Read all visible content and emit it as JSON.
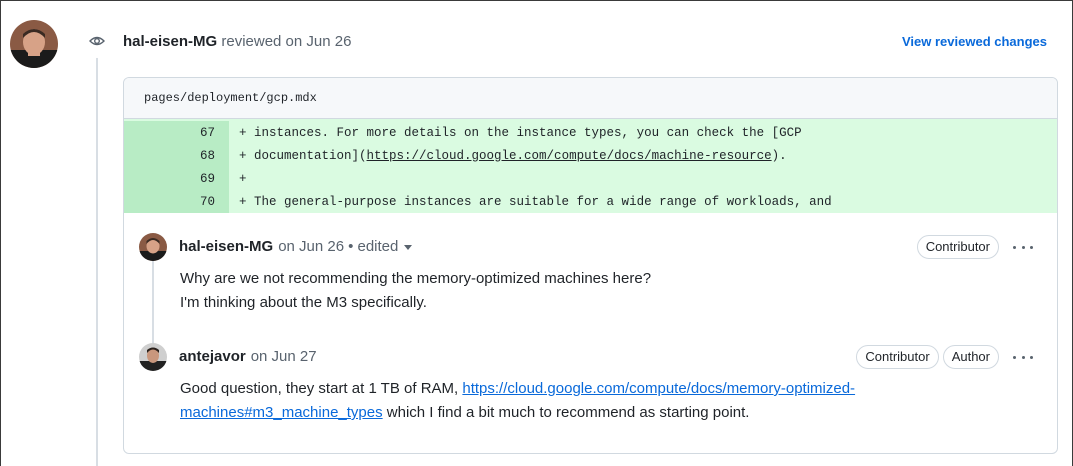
{
  "review": {
    "author": "hal-eisen-MG",
    "action": "reviewed on Jun 26",
    "view_changes_label": "View reviewed changes"
  },
  "file": {
    "path": "pages/deployment/gcp.mdx"
  },
  "diff_lines": [
    {
      "number": "67",
      "text": "+ instances. For more details on the instance types, you can check the [GCP"
    },
    {
      "number": "68",
      "text_before": "+ documentation](",
      "link": "https://cloud.google.com/compute/docs/machine-resource",
      "text_after": ")."
    },
    {
      "number": "69",
      "text": "+"
    },
    {
      "number": "70",
      "text": "+ The general-purpose instances are suitable for a wide range of workloads, and"
    }
  ],
  "comments": [
    {
      "author": "hal-eisen-MG",
      "date": "on Jun 26",
      "edited": "• edited",
      "badges": [
        "Contributor"
      ],
      "lines": [
        "Why are we not recommending the memory-optimized machines here?",
        "I'm thinking about the M3 specifically."
      ]
    },
    {
      "author": "antejavor",
      "date": "on Jun 27",
      "badges": [
        "Contributor",
        "Author"
      ],
      "text_before": "Good question, they start at 1 TB of RAM, ",
      "link_line1": "https://cloud.google.com/compute/docs/memory-optimized-",
      "link_line2": "machines#m3_machine_types",
      "text_after": " which I find a bit much to recommend as starting point."
    }
  ],
  "colors": {
    "link": "#0969da",
    "diff_added_bg": "#dafbe1",
    "diff_added_num_bg": "#b8ecc5"
  }
}
